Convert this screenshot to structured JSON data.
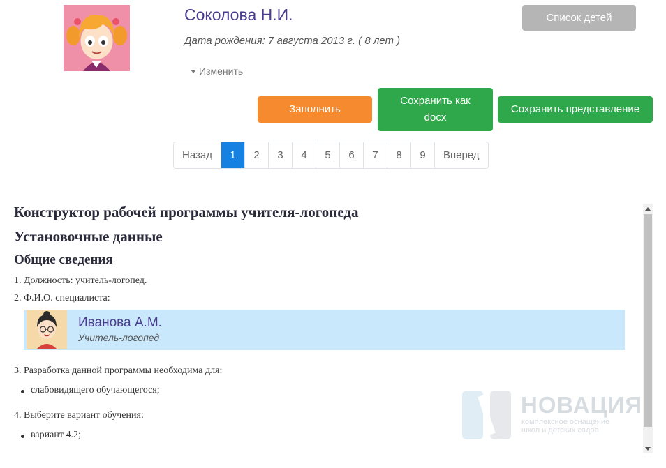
{
  "child": {
    "name": "Соколова Н.И.",
    "birth_info": "Дата рождения: 7 августа 2013 г. ( 8 лет )",
    "edit_label": "Изменить"
  },
  "buttons": {
    "children_list": "Список детей",
    "fill": "Заполнить",
    "save_docx": "Сохранить как docx",
    "save_view": "Сохранить представление"
  },
  "pagination": {
    "prev": "Назад",
    "next": "Вперед",
    "pages": [
      "1",
      "2",
      "3",
      "4",
      "5",
      "6",
      "7",
      "8",
      "9"
    ],
    "active": "1"
  },
  "document": {
    "title": "Конструктор рабочей программы учителя-логопеда",
    "section": "Установочные данные",
    "subsection": "Общие сведения",
    "item1": "1. Должность: учитель-логопед.",
    "item2": "2. Ф.И.О. специалиста:",
    "specialist": {
      "name": "Иванова А.М.",
      "role": "Учитель-логопед"
    },
    "item3": "3. Разработка данной программы необходима для:",
    "item3_bullet": "слабовидящего обучающегося;",
    "item4": "4. Выберите вариант обучения:",
    "item4_bullet": "вариант 4.2;"
  },
  "watermark": {
    "brand": "НОВАЦИЯ",
    "line1": "комплексное оснащение",
    "line2": "школ и детских садов"
  },
  "icons": {
    "avatar_child": "girl-avatar-icon",
    "avatar_specialist": "teacher-avatar-icon",
    "edit_caret": "caret-down-icon"
  }
}
